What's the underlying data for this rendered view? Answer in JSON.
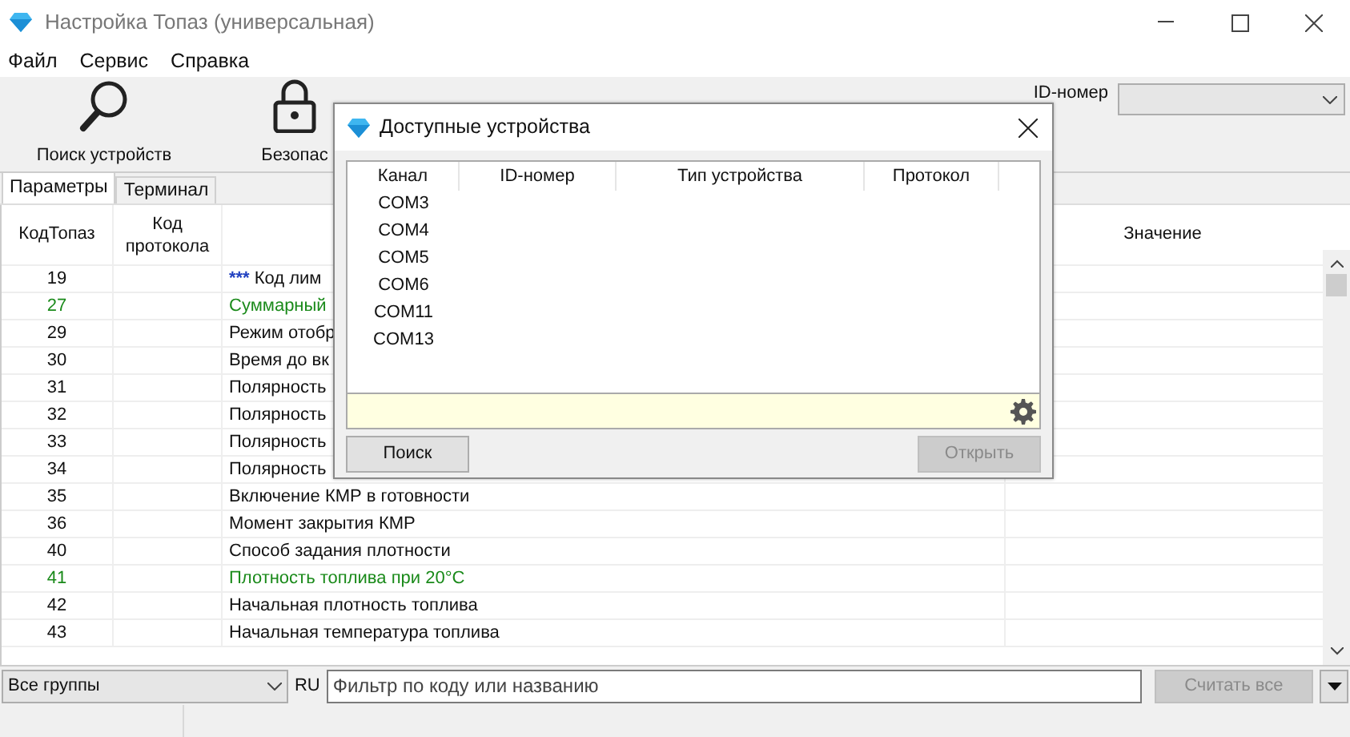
{
  "window": {
    "title": "Настройка Топаз (универсальная)"
  },
  "menu": [
    "Файл",
    "Сервис",
    "Справка"
  ],
  "toolbar": [
    {
      "kind": "search",
      "label": "Поиск устройств"
    },
    {
      "kind": "lock",
      "label": "Безопас"
    }
  ],
  "id_field": {
    "label": "ID-номер"
  },
  "tabs": [
    {
      "label": "Параметры",
      "selected": true
    },
    {
      "label": "Терминал",
      "selected": false
    }
  ],
  "table": {
    "columns": [
      "КодТопаз",
      "Код протокола",
      "Значение"
    ],
    "rows": [
      {
        "code": "19",
        "prefix": "***",
        "name": "Код лим",
        "highlight": false
      },
      {
        "code": "27",
        "name": "Суммарный",
        "highlight": true
      },
      {
        "code": "29",
        "name": "Режим отобр",
        "highlight": false
      },
      {
        "code": "30",
        "name": "Время до вк",
        "highlight": false
      },
      {
        "code": "31",
        "name": "Полярность",
        "highlight": false
      },
      {
        "code": "32",
        "name": "Полярность",
        "highlight": false
      },
      {
        "code": "33",
        "name": "Полярность",
        "highlight": false
      },
      {
        "code": "34",
        "name": "Полярность",
        "highlight": false
      },
      {
        "code": "35",
        "name": "Включение КМР в готовности",
        "highlight": false
      },
      {
        "code": "36",
        "name": "Момент закрытия КМР",
        "highlight": false
      },
      {
        "code": "40",
        "name": "Способ задания плотности",
        "highlight": false
      },
      {
        "code": "41",
        "name": "Плотность топлива при 20°C",
        "highlight": true
      },
      {
        "code": "42",
        "name": "Начальная плотность топлива",
        "highlight": false
      },
      {
        "code": "43",
        "name": "Начальная температура топлива",
        "highlight": false
      }
    ]
  },
  "bottom": {
    "group": "Все группы",
    "lang": "RU",
    "filter_placeholder": "Фильтр по коду или названию",
    "read_button": {
      "label": "Считать все",
      "disabled": true
    }
  },
  "dialog": {
    "title": "Доступные устройства",
    "columns": [
      "Канал",
      "ID-номер",
      "Тип устройства",
      "Протокол"
    ],
    "channels": [
      "COM3",
      "COM4",
      "COM5",
      "COM6",
      "COM11",
      "COM13"
    ],
    "buttons": [
      {
        "label": "Поиск",
        "disabled": false
      },
      {
        "label": "Открыть",
        "disabled": true
      }
    ]
  }
}
